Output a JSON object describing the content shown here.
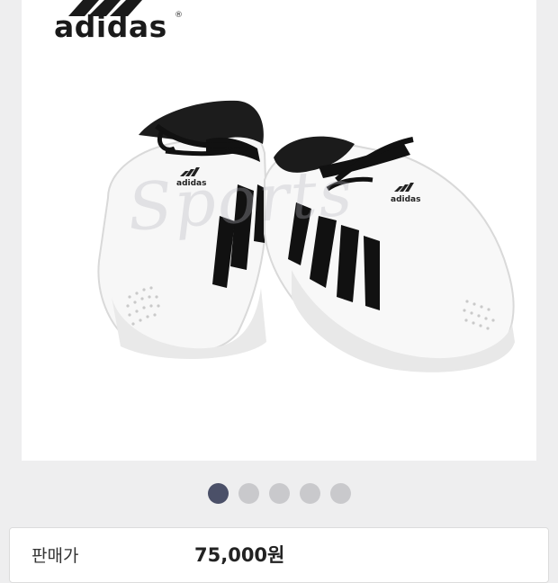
{
  "brand": {
    "name": "adidas",
    "reg_mark": "®"
  },
  "product_image": {
    "alt": "white taekwondo shoes with black stripes and black laces",
    "watermark": "Sports",
    "shoe_brand_mark": "adidas"
  },
  "carousel": {
    "dot_count": 5,
    "active_index": 0,
    "active_color": "#4b5068",
    "inactive_color": "#c9c9cc"
  },
  "price": {
    "label": "판매가",
    "value": "75,000원"
  }
}
